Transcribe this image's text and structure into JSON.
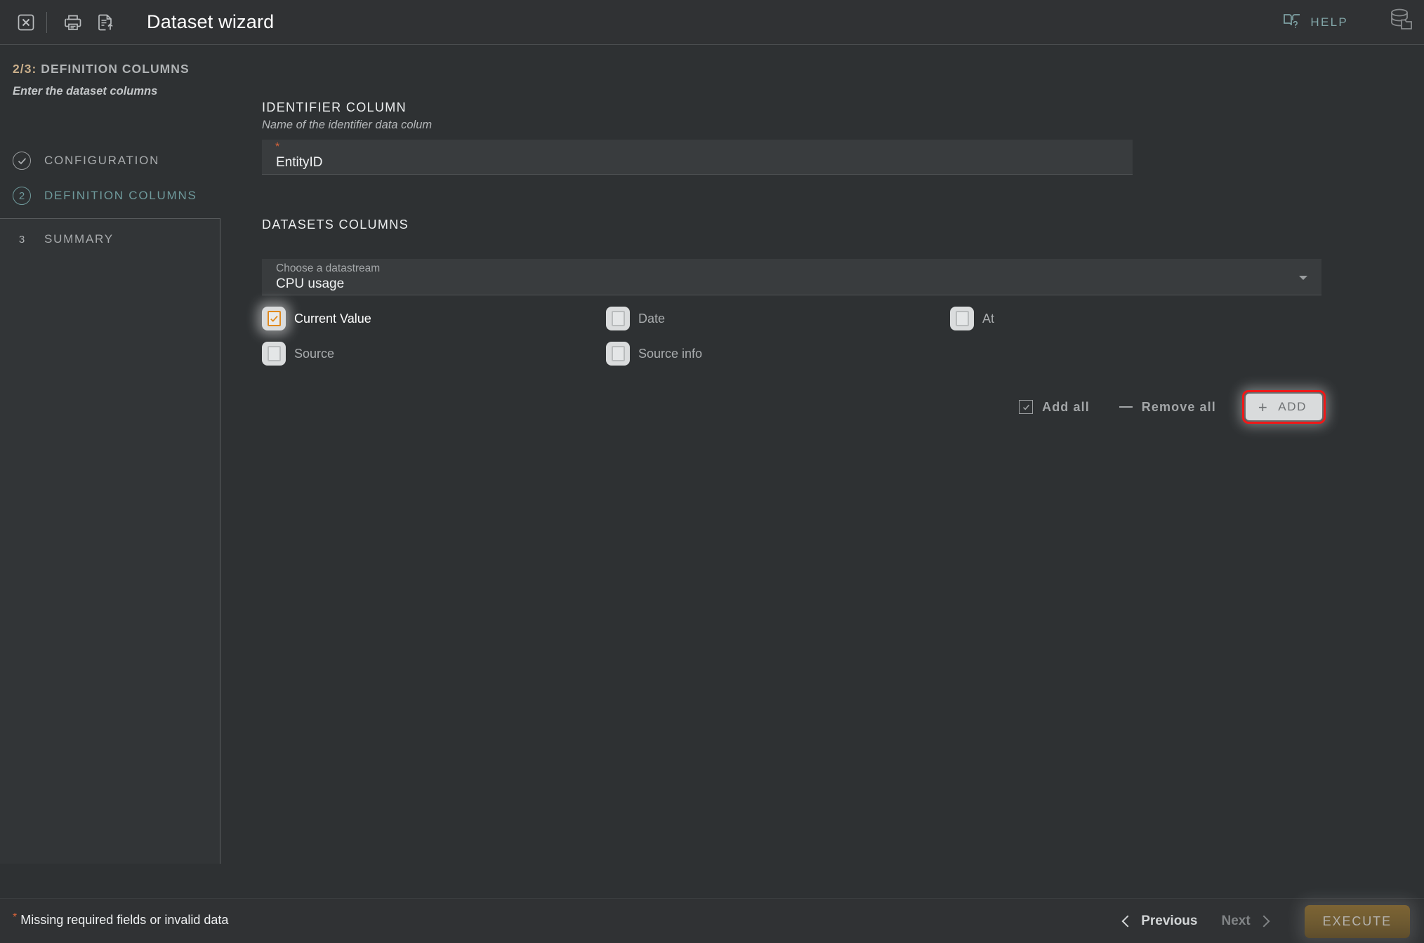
{
  "header": {
    "title": "Dataset wizard",
    "close_icon": "close-icon",
    "print_icon": "print-icon",
    "export_icon": "document-export-icon",
    "help_label": "HELP",
    "help_icon": "help-book-icon",
    "database_icon": "database-stack-icon"
  },
  "sidebar": {
    "step_counter": "2/3:",
    "step_title": "DEFINITION COLUMNS",
    "subtitle": "Enter the dataset columns",
    "steps": [
      {
        "marker": "",
        "label": "CONFIGURATION",
        "state": "done"
      },
      {
        "marker": "2",
        "label": "DEFINITION COLUMNS",
        "state": "current"
      },
      {
        "marker": "3",
        "label": "SUMMARY",
        "state": "pending"
      }
    ]
  },
  "main": {
    "identifier_section": {
      "title": "IDENTIFIER COLUMN",
      "subtitle": "Name of the identifier data colum",
      "required_marker": "*",
      "value": "EntityID",
      "placeholder": "Identifier column"
    },
    "datasets_section": {
      "title": "DATASETS COLUMNS",
      "datastream_label": "Choose a datastream",
      "datastream_value": "CPU usage",
      "datastream_options": [
        "CPU usage"
      ],
      "columns": [
        {
          "label": "Current Value",
          "checked": true,
          "highlighted": true
        },
        {
          "label": "Date",
          "checked": false,
          "highlighted": false
        },
        {
          "label": "At",
          "checked": false,
          "highlighted": false
        },
        {
          "label": "Source",
          "checked": false,
          "highlighted": false
        },
        {
          "label": "Source info",
          "checked": false,
          "highlighted": false
        },
        {
          "label": "",
          "checked": false,
          "highlighted": false
        }
      ],
      "add_all_label": "Add all",
      "remove_all_label": "Remove all",
      "add_button_label": "ADD",
      "add_button_plus": "+"
    }
  },
  "footer": {
    "validation_marker": "*",
    "validation_message": "Missing required fields or invalid data",
    "previous_label": "Previous",
    "next_label": "Next",
    "execute_label": "EXECUTE"
  },
  "colors": {
    "background": "#2e3133",
    "panel": "#323537",
    "field": "#393c3e",
    "accent_teal": "#6f9a9c",
    "accent_tan": "#c9ae8a",
    "accent_orange": "#e08a1e",
    "required_red": "#d9643a",
    "highlight_ring": "#f01818",
    "execute_gold": "#6e5a31"
  }
}
